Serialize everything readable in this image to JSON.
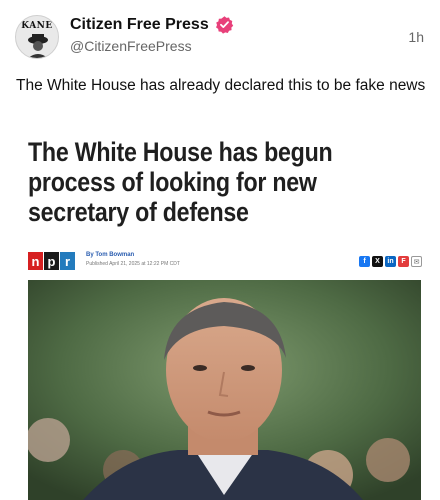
{
  "post": {
    "author": {
      "avatar_text": "KANE",
      "display_name": "Citizen Free Press",
      "handle": "@CitizenFreePress",
      "verified": true,
      "verified_color": "#e8407a"
    },
    "time": "1h",
    "text": "The White House has already declared this to be fake news"
  },
  "card": {
    "headline": "The White House has begun process of looking for new secretary of defense",
    "source_logo": [
      "n",
      "p",
      "r"
    ],
    "byline": "By Tom Bowman",
    "published": "Published April 21, 2025 at 12:22 PM CDT",
    "share_icons": [
      "facebook-icon",
      "x-icon",
      "linkedin-icon",
      "flipboard-icon",
      "email-icon"
    ],
    "share_labels": [
      "f",
      "X",
      "in",
      "F",
      "✉"
    ]
  },
  "colors": {
    "npr_red": "#d62021",
    "npr_black": "#1a1a1a",
    "npr_blue": "#237bbd",
    "byline_blue": "#2a5db0"
  }
}
